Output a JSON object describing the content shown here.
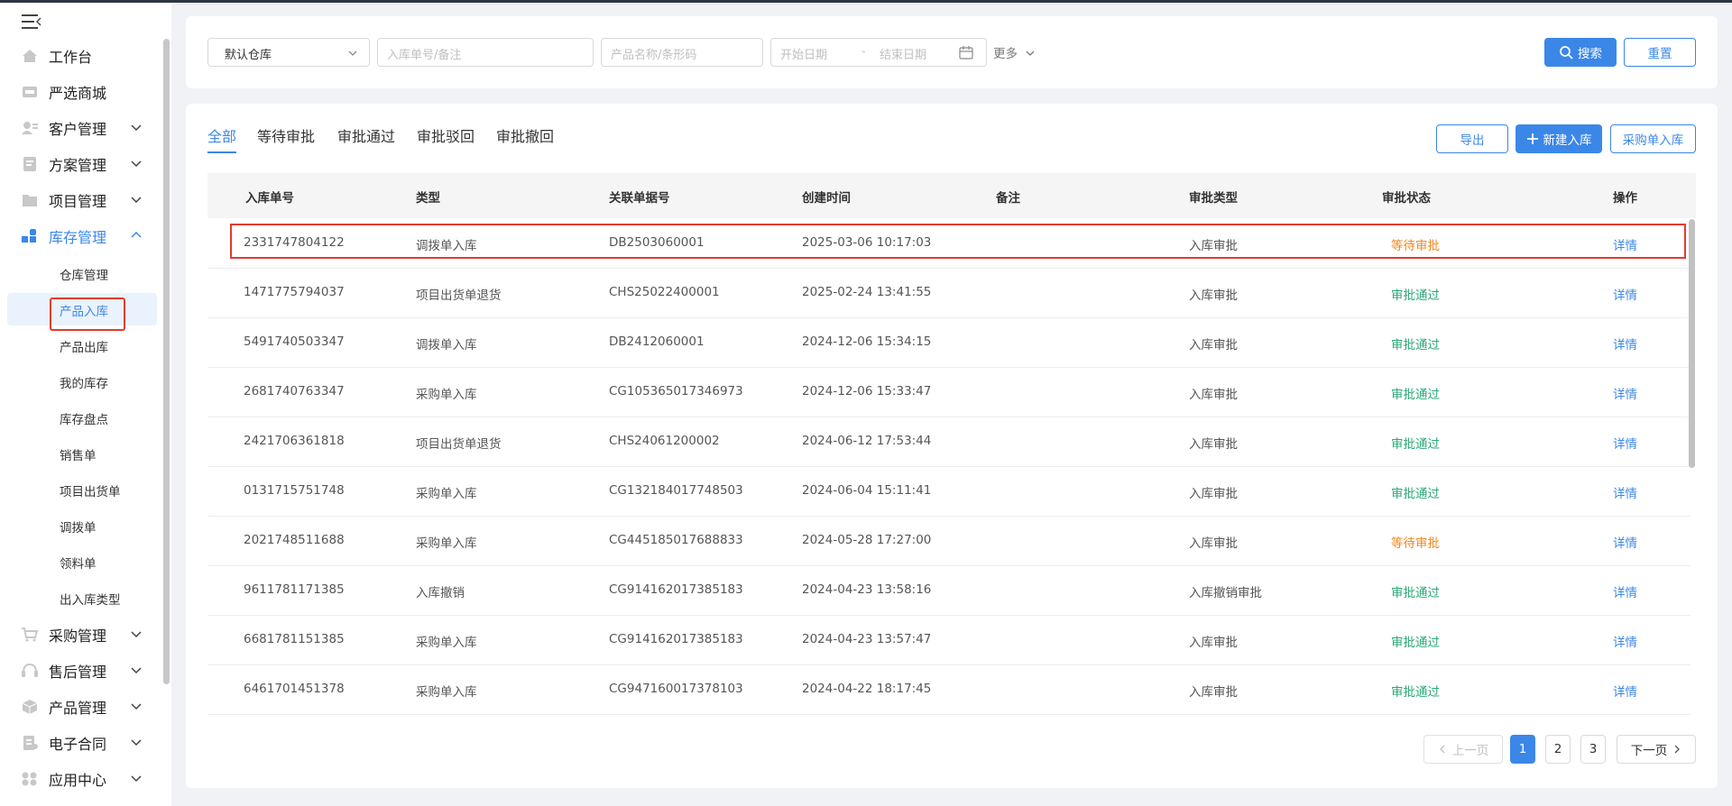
{
  "sidebar": {
    "menu": [
      {
        "label": "工作台"
      },
      {
        "label": "严选商城"
      },
      {
        "label": "客户管理"
      },
      {
        "label": "方案管理"
      },
      {
        "label": "项目管理"
      },
      {
        "label": "库存管理"
      },
      {
        "label": "采购管理"
      },
      {
        "label": "售后管理"
      },
      {
        "label": "产品管理"
      },
      {
        "label": "电子合同"
      },
      {
        "label": "应用中心"
      }
    ],
    "submenu": [
      {
        "label": "仓库管理"
      },
      {
        "label": "产品入库"
      },
      {
        "label": "产品出库"
      },
      {
        "label": "我的库存"
      },
      {
        "label": "库存盘点"
      },
      {
        "label": "销售单"
      },
      {
        "label": "项目出货单"
      },
      {
        "label": "调拨单"
      },
      {
        "label": "领料单"
      },
      {
        "label": "出入库类型"
      }
    ],
    "active_menu": "库存管理",
    "current_submenu": "产品入库"
  },
  "filters": {
    "warehouse_value": "默认仓库",
    "order_placeholder": "入库单号/备注",
    "product_placeholder": "产品名称/条形码",
    "start_date_placeholder": "开始日期",
    "date_separator": "-",
    "end_date_placeholder": "结束日期",
    "more_label": "更多",
    "search_label": "搜索",
    "reset_label": "重置"
  },
  "tabs": [
    {
      "label": "全部"
    },
    {
      "label": "等待审批"
    },
    {
      "label": "审批通过"
    },
    {
      "label": "审批驳回"
    },
    {
      "label": "审批撤回"
    }
  ],
  "active_tab": "全部",
  "actions": {
    "export_label": "导出",
    "new_label": "新建入库",
    "purchase_label": "采购单入库"
  },
  "table": {
    "columns": [
      "入库单号",
      "类型",
      "关联单据号",
      "创建时间",
      "备注",
      "审批类型",
      "审批状态",
      "操作"
    ],
    "rows": [
      {
        "no": "2331747804122",
        "type": "调拨单入库",
        "ref": "DB2503060001",
        "created": "2025-03-06 10:17:03",
        "note": "",
        "approval_type": "入库审批",
        "status": "等待审批",
        "status_kind": "pending",
        "op": "详情"
      },
      {
        "no": "1471775794037",
        "type": "项目出货单退货",
        "ref": "CHS25022400001",
        "created": "2025-02-24 13:41:55",
        "note": "",
        "approval_type": "入库审批",
        "status": "审批通过",
        "status_kind": "pass",
        "op": "详情"
      },
      {
        "no": "5491740503347",
        "type": "调拨单入库",
        "ref": "DB2412060001",
        "created": "2024-12-06 15:34:15",
        "note": "",
        "approval_type": "入库审批",
        "status": "审批通过",
        "status_kind": "pass",
        "op": "详情"
      },
      {
        "no": "2681740763347",
        "type": "采购单入库",
        "ref": "CG105365017346973",
        "created": "2024-12-06 15:33:47",
        "note": "",
        "approval_type": "入库审批",
        "status": "审批通过",
        "status_kind": "pass",
        "op": "详情"
      },
      {
        "no": "2421706361818",
        "type": "项目出货单退货",
        "ref": "CHS24061200002",
        "created": "2024-06-12 17:53:44",
        "note": "",
        "approval_type": "入库审批",
        "status": "审批通过",
        "status_kind": "pass",
        "op": "详情"
      },
      {
        "no": "0131715751748",
        "type": "采购单入库",
        "ref": "CG132184017748503",
        "created": "2024-06-04 15:11:41",
        "note": "",
        "approval_type": "入库审批",
        "status": "审批通过",
        "status_kind": "pass",
        "op": "详情"
      },
      {
        "no": "2021748511688",
        "type": "采购单入库",
        "ref": "CG445185017688833",
        "created": "2024-05-28 17:27:00",
        "note": "",
        "approval_type": "入库审批",
        "status": "等待审批",
        "status_kind": "pending",
        "op": "详情"
      },
      {
        "no": "9611781171385",
        "type": "入库撤销",
        "ref": "CG914162017385183",
        "created": "2024-04-23 13:58:16",
        "note": "",
        "approval_type": "入库撤销审批",
        "status": "审批通过",
        "status_kind": "pass",
        "op": "详情"
      },
      {
        "no": "6681781151385",
        "type": "采购单入库",
        "ref": "CG914162017385183",
        "created": "2024-04-23 13:57:47",
        "note": "",
        "approval_type": "入库审批",
        "status": "审批通过",
        "status_kind": "pass",
        "op": "详情"
      },
      {
        "no": "6461701451378",
        "type": "采购单入库",
        "ref": "CG947160017378103",
        "created": "2024-04-22 18:17:45",
        "note": "",
        "approval_type": "入库审批",
        "status": "审批通过",
        "status_kind": "pass",
        "op": "详情"
      }
    ]
  },
  "pagination": {
    "prev_label": "上一页",
    "pages": [
      "1",
      "2",
      "3"
    ],
    "current_page": "1",
    "next_label": "下一页"
  },
  "colors": {
    "accent": "#3b87e8",
    "pending": "#f08a24",
    "pass": "#2aa876",
    "highlight": "#e23b2e"
  }
}
